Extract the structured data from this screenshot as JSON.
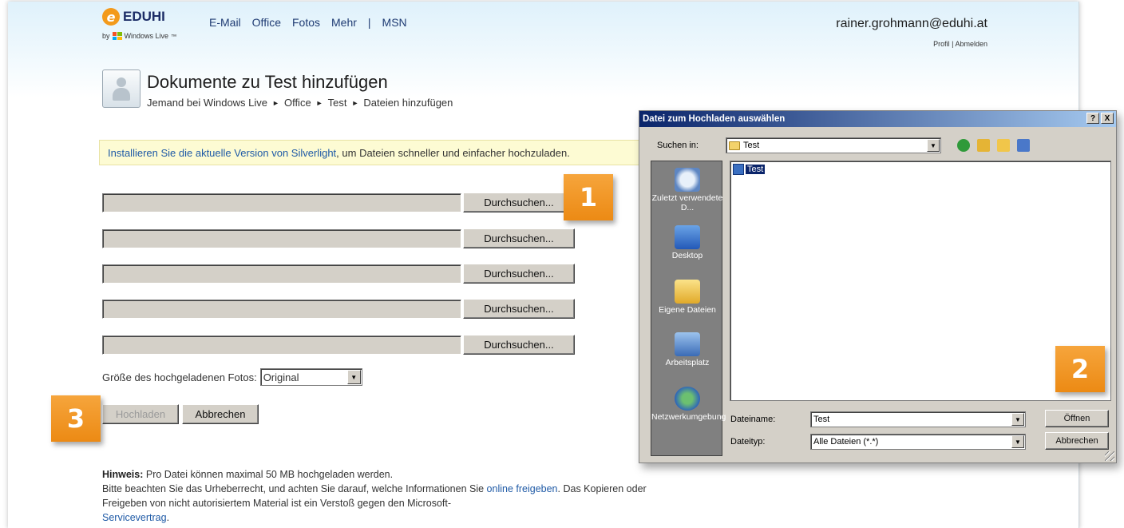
{
  "header": {
    "brand": "EDUHI",
    "logo_letter": "e",
    "by_prefix": "by",
    "by_label": "Windows Live",
    "trademark": "™",
    "nav": [
      "E-Mail",
      "Office",
      "Fotos",
      "Mehr",
      "|",
      "MSN"
    ],
    "user_email": "rainer.grohmann@eduhi.at",
    "profile": "Profil",
    "separator": "|",
    "logout": "Abmelden"
  },
  "page": {
    "title": "Dokumente zu Test hinzufügen",
    "breadcrumb": [
      "Jemand bei Windows Live",
      "Office",
      "Test",
      "Dateien hinzufügen"
    ],
    "breadcrumb_sep": "►"
  },
  "notice": {
    "link": "Installieren Sie die aktuelle Version von Silverlight",
    "text": ", um Dateien schneller und einfacher hochzuladen."
  },
  "files": {
    "browse_label": "Durchsuchen...",
    "rows": [
      "",
      "",
      "",
      "",
      ""
    ]
  },
  "size": {
    "label": "Größe des hochgeladenen Fotos:",
    "value": "Original"
  },
  "actions": {
    "upload": "Hochladen",
    "cancel": "Abbrechen"
  },
  "hint": {
    "bold": "Hinweis:",
    "line1": " Pro Datei können maximal 50 MB hochgeladen werden.",
    "line2a": "Bitte beachten Sie das Urheberrecht, und achten Sie darauf, welche Informationen Sie ",
    "line2link": "online freigeben",
    "line2b": ". Das Kopieren oder Freigeben von nicht autorisiertem Material ist ein Verstoß gegen den Microsoft-",
    "line3link": "Servicevertrag",
    "line3end": "."
  },
  "badges": [
    "1",
    "2",
    "3"
  ],
  "dialog": {
    "title": "Datei zum Hochladen auswählen",
    "help_btn": "?",
    "close_btn": "X",
    "lookin_label": "Suchen in:",
    "lookin_value": "Test",
    "places": [
      "Zuletzt verwendete D...",
      "Desktop",
      "Eigene Dateien",
      "Arbeitsplatz",
      "Netzwerkumgebung"
    ],
    "file_item": "Test",
    "filename_label": "Dateiname:",
    "filename_value": "Test",
    "filetype_label": "Dateityp:",
    "filetype_value": "Alle Dateien (*.*)",
    "open_btn": "Öffnen",
    "cancel_btn": "Abbrechen"
  },
  "colors": {
    "accent_orange": "#f39a1b",
    "link_blue": "#1f5aa6",
    "title_bar": "#0a246a"
  }
}
